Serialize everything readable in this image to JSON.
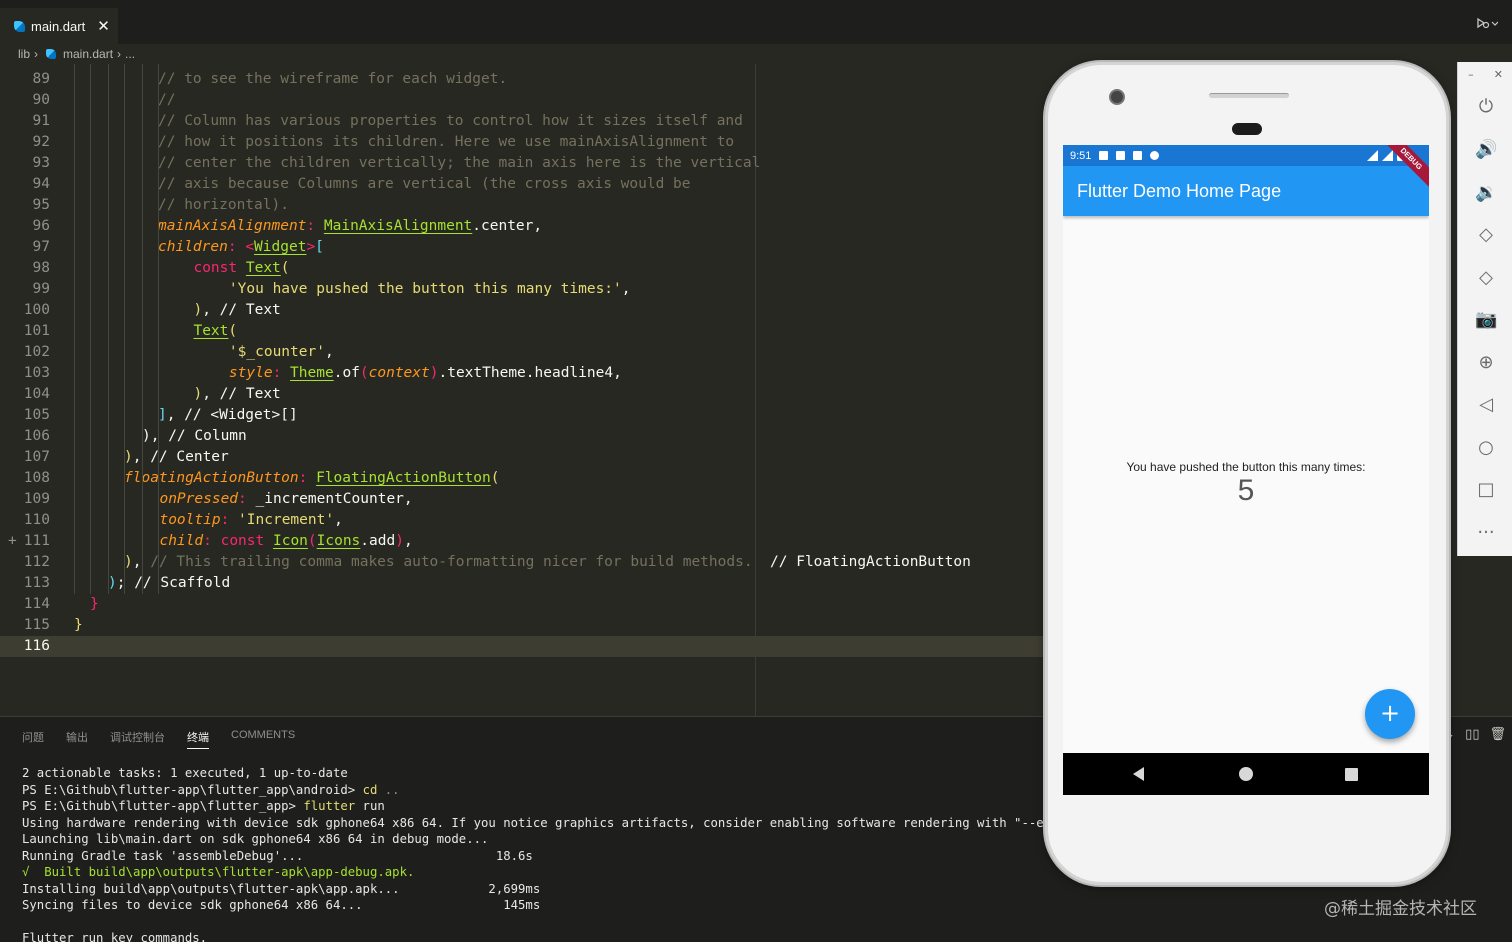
{
  "editor_tab": {
    "filename": "main.dart",
    "close_glyph": "✕"
  },
  "breadcrumb": {
    "folder": "lib",
    "file": "main.dart",
    "tail": "..."
  },
  "code_lines": [
    {
      "n": "89",
      "html": "<span class=\"c\">// to see the wireframe for each widget.</span>"
    },
    {
      "n": "90",
      "html": "<span class=\"c\">//</span>"
    },
    {
      "n": "91",
      "html": "<span class=\"c\">// Column has various properties to control how it sizes itself and</span>"
    },
    {
      "n": "92",
      "html": "<span class=\"c\">// how it positions its children. Here we use mainAxisAlignment to</span>"
    },
    {
      "n": "93",
      "html": "<span class=\"c\">// center the children vertically; the main axis here is the vertical</span>"
    },
    {
      "n": "94",
      "html": "<span class=\"c\">// axis because Columns are vertical (the cross axis would be</span>"
    },
    {
      "n": "95",
      "html": "<span class=\"c\">// horizontal).</span>"
    },
    {
      "n": "96",
      "html": "<span class=\"p\">mainAxisAlignment</span><span class=\"k\">:</span> <span class=\"t\">MainAxisAlignment</span>.center,"
    },
    {
      "n": "97",
      "html": "<span class=\"p\">children</span><span class=\"k\">:</span> <span class=\"k\">&lt;</span><span class=\"t\">Widget</span><span class=\"k\">&gt;</span><span class=\"bblue\">[</span>"
    },
    {
      "n": "98",
      "html": "  <span class=\"k\">const</span> <span class=\"t\">Text</span><span class=\"by\">(</span>"
    },
    {
      "n": "99",
      "html": "    <span class=\"s\">'You have pushed the button this many times:'</span>,"
    },
    {
      "n": "100",
      "html": "  <span class=\"by\">)</span>, <span class=\"w\">// Text</span>"
    },
    {
      "n": "101",
      "html": "  <span class=\"t\">Text</span><span class=\"by\">(</span>"
    },
    {
      "n": "102",
      "html": "    <span class=\"s\">'$_counter'</span>,"
    },
    {
      "n": "103",
      "html": "    <span class=\"p\">style</span><span class=\"k\">:</span> <span class=\"t\">Theme</span>.<span class=\"w\">of</span><span class=\"bpink\">(</span><span class=\"p\">context</span><span class=\"bpink\">)</span>.textTheme.headline4,"
    },
    {
      "n": "104",
      "html": "  <span class=\"by\">)</span>, <span class=\"w\">// Text</span>"
    },
    {
      "n": "105",
      "html": "<span class=\"bblue\">]</span>, <span class=\"w\">// &lt;Widget&gt;[]</span>"
    },
    {
      "n": "106",
      "html": "<span class=\"w\">), // Column</span>"
    },
    {
      "n": "107",
      "html": "<span class=\"by\">)</span>, <span class=\"w\">// Center</span>"
    },
    {
      "n": "108",
      "html": "<span class=\"p\">floatingActionButton</span><span class=\"k\">:</span> <span class=\"t\">FloatingActionButton</span><span class=\"by\">(</span>"
    },
    {
      "n": "109",
      "html": "  <span class=\"p\">onPressed</span><span class=\"k\">:</span> _incrementCounter,"
    },
    {
      "n": "110",
      "html": "  <span class=\"p\">tooltip</span><span class=\"k\">:</span> <span class=\"s\">'Increment'</span>,"
    },
    {
      "n": "111",
      "html": "  <span class=\"p\">child</span><span class=\"k\">:</span> <span class=\"k\">const</span> <span class=\"t\">Icon</span><span class=\"bpink\">(</span><span class=\"t\">Icons</span>.add<span class=\"bpink\">)</span>,"
    },
    {
      "n": "112",
      "html": "<span class=\"by\">)</span>, <span class=\"c\">// This trailing comma makes auto-formatting nicer for build methods.</span>  <span class=\"w\">// FloatingActionButton</span>"
    },
    {
      "n": "113",
      "html": "<span class=\"bblue\">)</span>; <span class=\"w\">// Scaffold</span>"
    },
    {
      "n": "114",
      "html": "<span class=\"bpink\">}</span>"
    },
    {
      "n": "115",
      "html": "<span class=\"by\">}</span>"
    },
    {
      "n": "116",
      "html": ""
    }
  ],
  "git_plus_mark": "+",
  "panel": {
    "tabs": [
      "问题",
      "输出",
      "调试控制台",
      "终端",
      "COMMENTS"
    ],
    "active_tab": "终端"
  },
  "terminal_lines": [
    "2 actionable tasks: 1 executed, 1 up-to-date",
    "PS E:\\Github\\flutter-app\\flutter_app\\android> <span class=\"y\">cd</span> <span class=\"d\">..</span>",
    "PS E:\\Github\\flutter-app\\flutter_app> <span class=\"y\">flutter</span> run",
    "Using hardware rendering with device sdk gphone64 x86 64. If you notice graphics artifacts, consider enabling software rendering with \"--enable-software-rendering\".",
    "Launching lib\\main.dart on sdk gphone64 x86 64 in debug mode...",
    "Running Gradle task 'assembleDebug'...                          18.6s",
    "<span class=\"g\">√  Built build\\app\\outputs\\flutter-apk\\app-debug.apk.</span>",
    "Installing build\\app\\outputs\\flutter-apk\\app.apk...            2,699ms",
    "Syncing files to device sdk gphone64 x86 64...                   145ms",
    "",
    "Flutter run key commands."
  ],
  "emulator": {
    "status_time": "9:51",
    "app_title": "Flutter Demo Home Page",
    "debug_banner": "DEBUG",
    "counter_label": "You have pushed the button this many times:",
    "counter_value": "5",
    "fab_icon": "+"
  },
  "watermark": "@稀土掘金技术社区",
  "colors": {
    "editor_bg": "#272822",
    "appbar": "#2196f3",
    "statusbar": "#1976d2",
    "debug_banner": "#a6193b"
  }
}
